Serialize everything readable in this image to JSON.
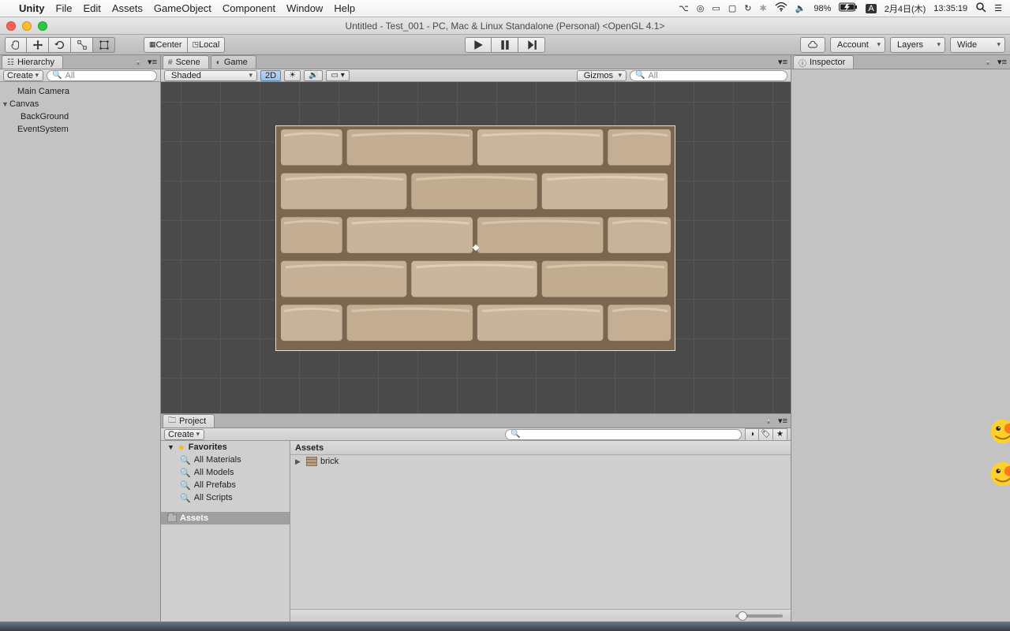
{
  "mac_menu": {
    "app": "Unity",
    "items": [
      "File",
      "Edit",
      "Assets",
      "GameObject",
      "Component",
      "Window",
      "Help"
    ],
    "battery_pct": "98%",
    "date": "2月4日(木)",
    "time": "13:35:19",
    "input_badge": "A"
  },
  "window": {
    "title": "Untitled - Test_001 - PC, Mac & Linux Standalone (Personal) <OpenGL 4.1>"
  },
  "toolbar": {
    "pivot": "Center",
    "handle": "Local",
    "account": "Account",
    "layers": "Layers",
    "layout": "Wide"
  },
  "hierarchy": {
    "tab": "Hierarchy",
    "create": "Create",
    "search_placeholder": "All",
    "items": [
      {
        "label": "Main Camera",
        "indent": 0
      },
      {
        "label": "Canvas",
        "indent": 0,
        "expanded": true
      },
      {
        "label": "BackGround",
        "indent": 1
      },
      {
        "label": "EventSystem",
        "indent": 0
      }
    ]
  },
  "scene": {
    "tab_scene": "Scene",
    "tab_game": "Game",
    "shaded": "Shaded",
    "mode2d": "2D",
    "gizmos": "Gizmos",
    "search_placeholder": "All"
  },
  "project": {
    "tab": "Project",
    "create": "Create",
    "favorites_label": "Favorites",
    "favorites": [
      "All Materials",
      "All Models",
      "All Prefabs",
      "All Scripts"
    ],
    "root_folder": "Assets",
    "breadcrumb": "Assets",
    "assets": [
      {
        "name": "brick",
        "type": "texture"
      }
    ]
  },
  "inspector": {
    "tab": "Inspector"
  }
}
